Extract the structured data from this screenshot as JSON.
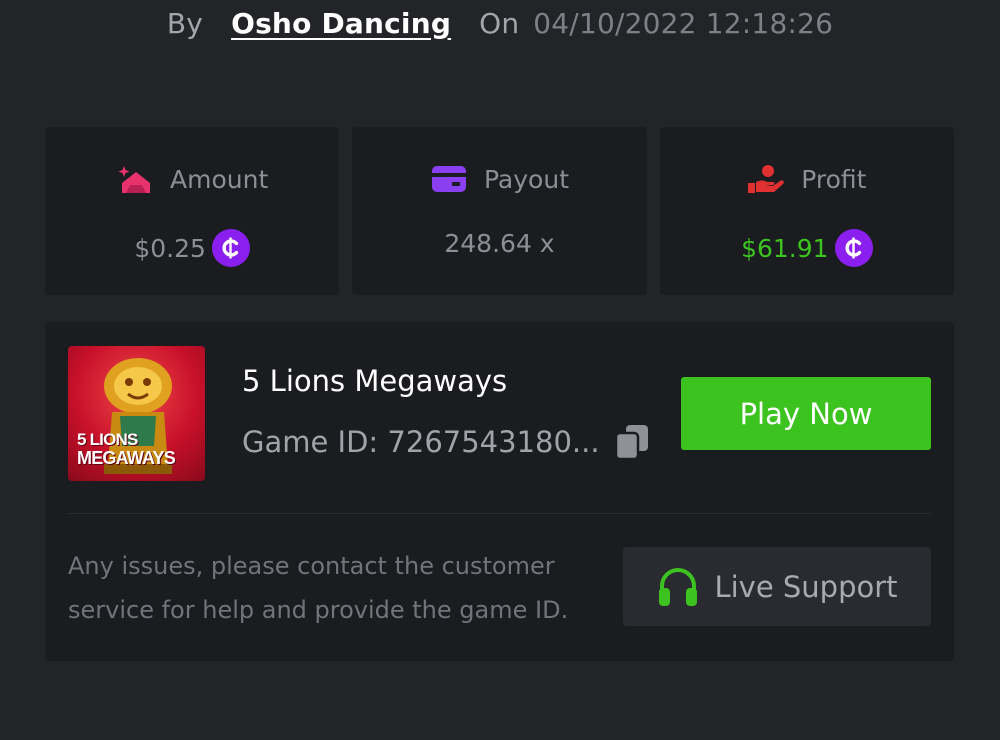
{
  "byline": {
    "by_label": "By",
    "username": "Osho Dancing",
    "on_label": "On",
    "datetime": "04/10/2022 12:18:26"
  },
  "stats": {
    "amount": {
      "label": "Amount",
      "value": "$0.25",
      "icon": "amount-icon",
      "icon_color": "#e8326e"
    },
    "payout": {
      "label": "Payout",
      "value": "248.64 x",
      "icon": "card-icon",
      "icon_color": "#8a3ff0"
    },
    "profit": {
      "label": "Profit",
      "value": "$61.91",
      "icon": "hand-coin-icon",
      "icon_color": "#e03030",
      "value_color": "#3cc31f"
    }
  },
  "game": {
    "title": "5 Lions Megaways",
    "thumbnail_line1": "5 LIONS",
    "thumbnail_line2": "MEGAWAYS",
    "id_label": "Game ID: 7267543180...",
    "play_label": "Play Now"
  },
  "support": {
    "message": "Any issues, please contact the customer service for help and provide the game ID.",
    "button_label": "Live Support"
  },
  "colors": {
    "background": "#232428",
    "card": "#1b1c20",
    "accent_green": "#3cc31f",
    "coin_purple": "#8b1ff0"
  }
}
